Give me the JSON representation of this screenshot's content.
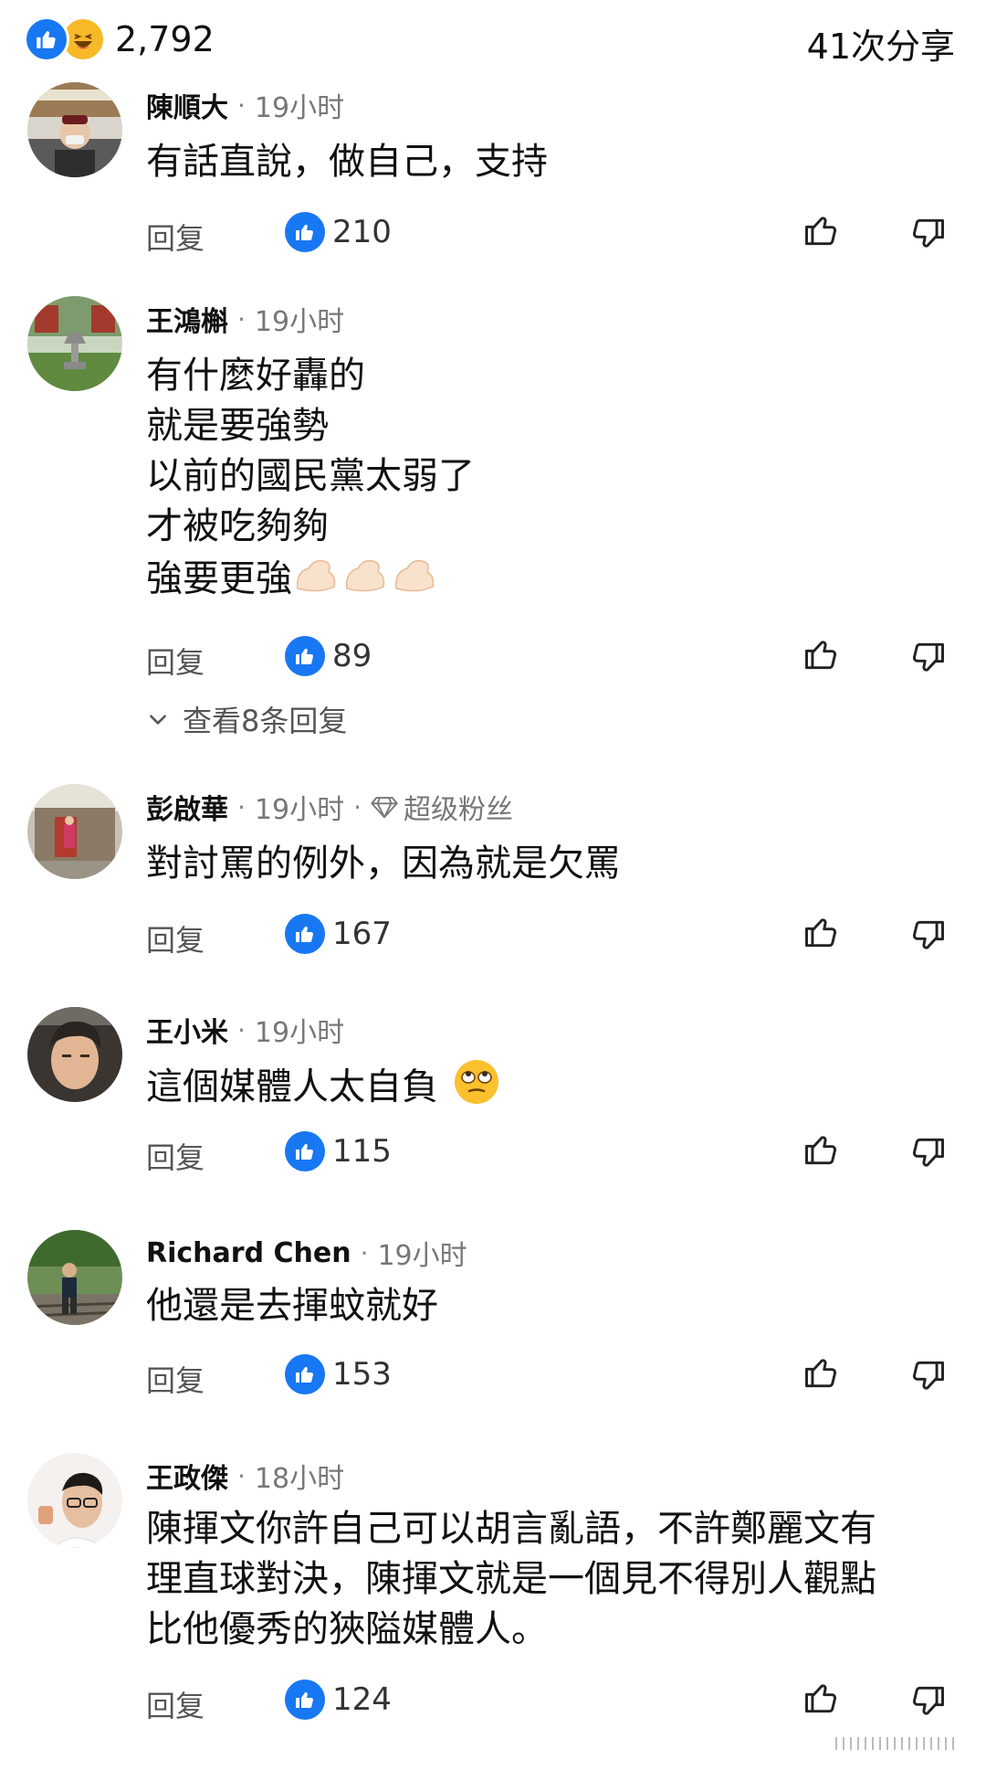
{
  "header": {
    "reaction_count": "2,792",
    "shares": "41次分享"
  },
  "reply_label": "回复",
  "comments": [
    {
      "author": "陳順大",
      "time": "19小时",
      "lines": [
        "有話直說，做自己，支持"
      ],
      "likes": "210"
    },
    {
      "author": "王鴻槲",
      "time": "19小时",
      "lines": [
        "有什麼好轟的",
        "就是要強勢",
        "以前的國民黨太弱了",
        "才被吃夠夠",
        "強要更強"
      ],
      "likes": "89",
      "view_replies": "查看8条回复"
    },
    {
      "author": "彭啟華",
      "time": "19小时",
      "badge": "超级粉丝",
      "lines": [
        "對討罵的例外，因為就是欠罵"
      ],
      "likes": "167"
    },
    {
      "author": "王小米",
      "time": "19小时",
      "lines": [
        "這個媒體人太自負"
      ],
      "likes": "115"
    },
    {
      "author": "Richard Chen",
      "time": "19小时",
      "lines": [
        "他還是去揮蚊就好"
      ],
      "likes": "153"
    },
    {
      "author": "王政傑",
      "time": "18小时",
      "lines": [
        "陳揮文你許自己可以胡言亂語，不許鄭麗文有",
        "理直球對決，陳揮文就是一個見不得別人觀點",
        "比他優秀的狹隘媒體人。"
      ],
      "likes": "124"
    }
  ],
  "colors": {
    "like_blue": "#1877f2",
    "haha_yellow": "#f7b928",
    "muted": "#777777"
  },
  "icons": [
    "like-reaction-icon",
    "haha-reaction-icon",
    "thumbs-up-icon",
    "thumbs-down-icon",
    "diamond-icon",
    "chevron-down-icon",
    "flexed-biceps-emoji",
    "face-with-rolling-eyes-emoji"
  ]
}
